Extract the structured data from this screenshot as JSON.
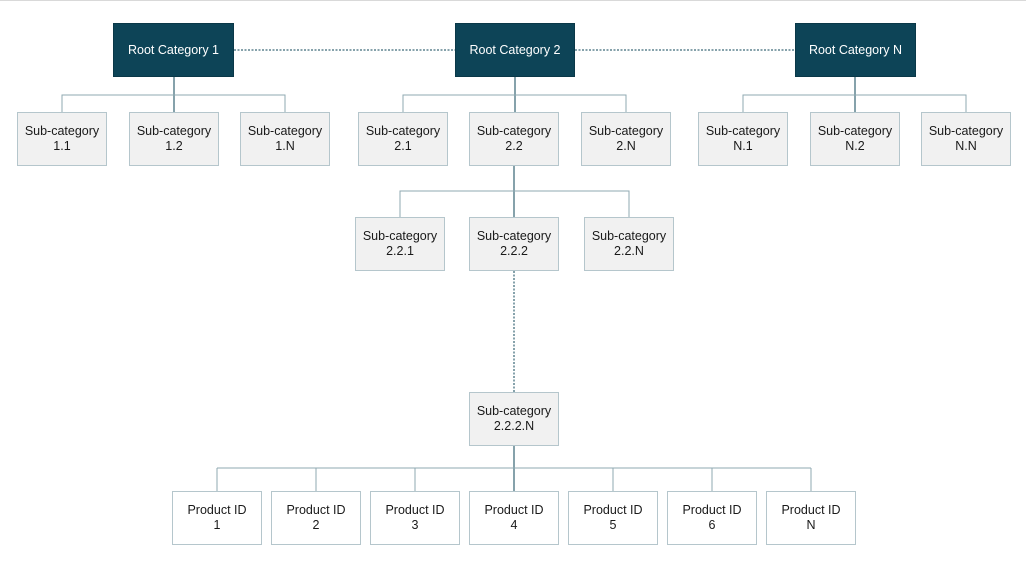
{
  "diagram": {
    "type": "hierarchy",
    "colors": {
      "root_fill": "#0d4457",
      "root_text": "#ffffff",
      "sub_fill": "#f1f1f1",
      "product_fill": "#ffffff",
      "node_border": "#b5c6cc",
      "connector": "#8fa9b2",
      "connector_dark": "#0d4457"
    },
    "roots": [
      {
        "label": "Root Category 1"
      },
      {
        "label": "Root Category 2"
      },
      {
        "label": "Root Category N"
      }
    ],
    "subcategories_level1": {
      "root1": [
        {
          "line1": "Sub-category",
          "line2": "1.1"
        },
        {
          "line1": "Sub-category",
          "line2": "1.2"
        },
        {
          "line1": "Sub-category",
          "line2": "1.N"
        }
      ],
      "root2": [
        {
          "line1": "Sub-category",
          "line2": "2.1"
        },
        {
          "line1": "Sub-category",
          "line2": "2.2"
        },
        {
          "line1": "Sub-category",
          "line2": "2.N"
        }
      ],
      "rootN": [
        {
          "line1": "Sub-category",
          "line2": "N.1"
        },
        {
          "line1": "Sub-category",
          "line2": "N.2"
        },
        {
          "line1": "Sub-category",
          "line2": "N.N"
        }
      ]
    },
    "subcategories_level2": [
      {
        "line1": "Sub-category",
        "line2": "2.2.1"
      },
      {
        "line1": "Sub-category",
        "line2": "2.2.2"
      },
      {
        "line1": "Sub-category",
        "line2": "2.2.N"
      }
    ],
    "subcategory_level_n": {
      "line1": "Sub-category",
      "line2": "2.2.2.N"
    },
    "products": [
      {
        "line1": "Product ID",
        "line2": "1"
      },
      {
        "line1": "Product ID",
        "line2": "2"
      },
      {
        "line1": "Product ID",
        "line2": "3"
      },
      {
        "line1": "Product ID",
        "line2": "4"
      },
      {
        "line1": "Product ID",
        "line2": "5"
      },
      {
        "line1": "Product ID",
        "line2": "6"
      },
      {
        "line1": "Product ID",
        "line2": "N"
      }
    ]
  }
}
